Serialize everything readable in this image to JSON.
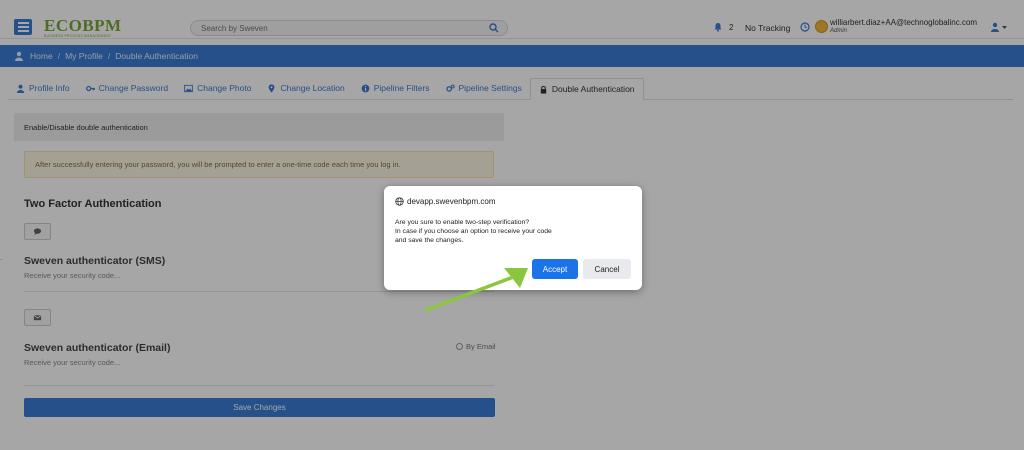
{
  "header": {
    "logo_text": "ECOBPM",
    "logo_tagline": "BUSINESS PROCESS MANAGEMENT",
    "search_placeholder": "Search by Sweven",
    "notifications_count": "2",
    "tracking_status": "No Tracking",
    "user_email": "williarbert.diaz+AA@technoglobalinc.com",
    "user_role": "Admin"
  },
  "breadcrumb": {
    "items": [
      "Home",
      "My Profile",
      "Double Authentication"
    ],
    "separator": "/"
  },
  "tabs": [
    {
      "label": "Profile Info",
      "icon": "user-icon",
      "active": false
    },
    {
      "label": "Change Password",
      "icon": "key-icon",
      "active": false
    },
    {
      "label": "Change Photo",
      "icon": "image-icon",
      "active": false
    },
    {
      "label": "Change Location",
      "icon": "map-marker-icon",
      "active": false
    },
    {
      "label": "Pipeline Filters",
      "icon": "info-icon",
      "active": false
    },
    {
      "label": "Pipeline Settings",
      "icon": "cogs-icon",
      "active": false
    },
    {
      "label": "Double Authentication",
      "icon": "lock-icon",
      "active": true
    }
  ],
  "panel": {
    "heading": "Enable/Disable double authentication",
    "alert": "After successfully entering your password, you will be prompted to enter a one-time code each time you log in.",
    "section_title": "Two Factor Authentication",
    "methods": [
      {
        "title": "Sweven authenticator (SMS)",
        "subtitle": "Receive your security code...",
        "icon": "comment-icon"
      },
      {
        "title": "Sweven authenticator (Email)",
        "subtitle": "Receive your security code...",
        "icon": "envelope-icon",
        "option": "By Email"
      }
    ],
    "save_label": "Save Changes"
  },
  "dialog": {
    "origin": "devapp.swevenbpm.com",
    "lines": [
      "Are you sure to enable two-step verification?",
      "In case if you choose an option to receive your code",
      "and save the changes."
    ],
    "accept_label": "Accept",
    "cancel_label": "Cancel"
  },
  "colors": {
    "primary": "#3a7bd5",
    "dialog_accept": "#1a73e8",
    "annotation_arrow": "#8cc63f",
    "alert_bg": "#fcf8e3"
  }
}
